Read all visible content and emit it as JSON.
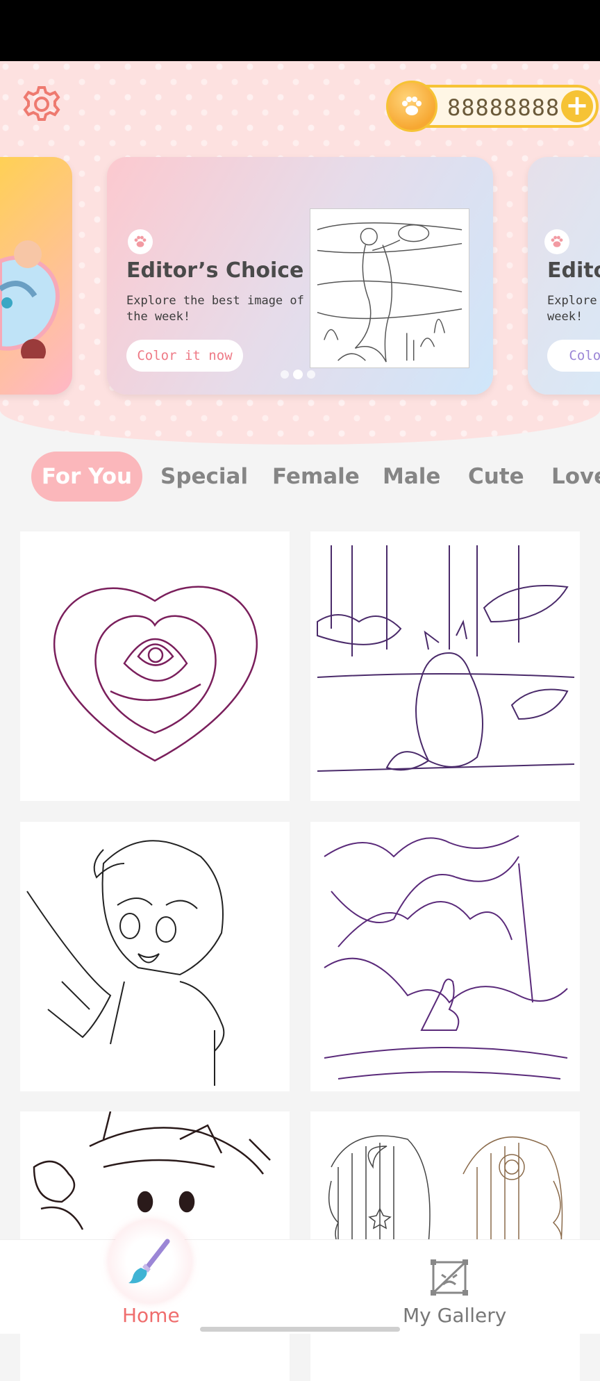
{
  "header": {
    "settings_icon": "gear-icon",
    "coins": {
      "amount": "88888888",
      "icon": "paw-coin-icon",
      "add_icon": "plus-icon"
    }
  },
  "banner": {
    "title": "Editor’s Choice",
    "subtitle": "Explore the best image of the week!",
    "cta": "Color it now",
    "next_title": "Edito",
    "next_subtitle_1": "Explore t",
    "next_subtitle_2": "week!",
    "next_cta": "Color",
    "page_count": 3,
    "active_page": 2
  },
  "tabs": [
    {
      "label": "For You",
      "active": true
    },
    {
      "label": "Special"
    },
    {
      "label": "Female"
    },
    {
      "label": "Male"
    },
    {
      "label": "Cute"
    },
    {
      "label": "Love"
    }
  ],
  "cards": [
    {
      "name": "heart-rose"
    },
    {
      "name": "fox-in-forest"
    },
    {
      "name": "anime-boy"
    },
    {
      "name": "howling-wolf"
    },
    {
      "name": "cat-witch-hat"
    },
    {
      "name": "moon-sun-faces"
    }
  ],
  "bottom_nav": {
    "home": {
      "label": "Home",
      "icon": "paintbrush-icon"
    },
    "gallery": {
      "label": "My Gallery",
      "icon": "gallery-frame-icon"
    }
  },
  "colors": {
    "accent": "#ef6d6d",
    "tab_active_bg": "#fbb7bb",
    "coin": "#f6c335",
    "header_bg": "#fde1e0"
  }
}
